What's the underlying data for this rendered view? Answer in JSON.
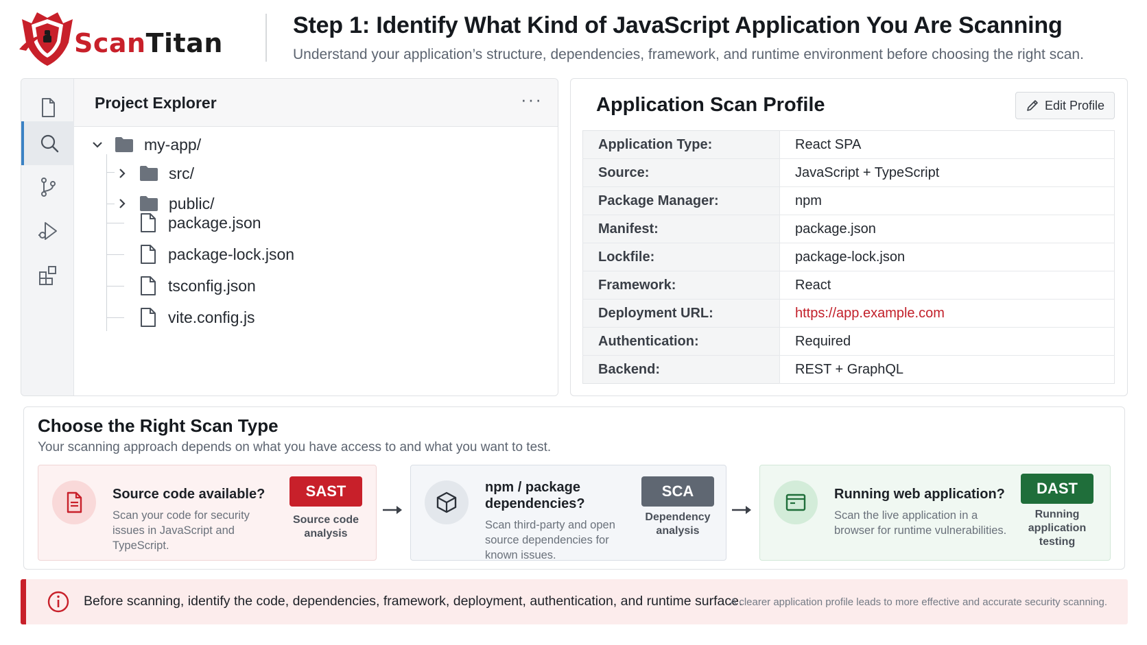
{
  "brand": {
    "name_part1": "Scan",
    "name_part2": "Titan"
  },
  "header": {
    "title": "Step 1: Identify What Kind of JavaScript Application You Are Scanning",
    "subtitle": "Understand your application’s structure, dependencies, framework, and runtime environment before choosing the right scan."
  },
  "explorer": {
    "title": "Project Explorer",
    "more": "···",
    "activity_icons": [
      "files-icon",
      "search-icon",
      "source-control-icon",
      "run-debug-icon",
      "extensions-icon"
    ],
    "tree": [
      {
        "label": "my-app/",
        "type": "folder",
        "expanded": true
      },
      {
        "label": "src/",
        "type": "folder",
        "expanded": false
      },
      {
        "label": "public/",
        "type": "folder",
        "expanded": false
      },
      {
        "label": "package.json",
        "type": "file"
      },
      {
        "label": "package-lock.json",
        "type": "file"
      },
      {
        "label": "tsconfig.json",
        "type": "file"
      },
      {
        "label": "vite.config.js",
        "type": "file"
      }
    ]
  },
  "profile": {
    "title": "Application Scan Profile",
    "edit_label": "Edit Profile",
    "rows": [
      {
        "key": "Application Type:",
        "value": "React SPA"
      },
      {
        "key": "Source:",
        "value": "JavaScript + TypeScript"
      },
      {
        "key": "Package Manager:",
        "value": "npm"
      },
      {
        "key": "Manifest:",
        "value": "package.json"
      },
      {
        "key": "Lockfile:",
        "value": "package-lock.json"
      },
      {
        "key": "Framework:",
        "value": "React"
      },
      {
        "key": "Deployment URL:",
        "value": "https://app.example.com"
      },
      {
        "key": "Authentication:",
        "value": "Required"
      },
      {
        "key": "Backend:",
        "value": "REST + GraphQL"
      }
    ]
  },
  "scan_types": {
    "title": "Choose the Right Scan Type",
    "subtitle": "Your scanning approach depends on what you have access to and what you want to test.",
    "cards": [
      {
        "heading": "Source code available?",
        "description": "Scan your code for security issues in JavaScript and TypeScript.",
        "badge": "SAST",
        "caption": "Source code analysis",
        "icon": "document-icon"
      },
      {
        "heading": "npm / package dependencies?",
        "description": "Scan third-party and open source dependencies for known issues.",
        "badge": "SCA",
        "caption": "Dependency analysis",
        "icon": "package-icon"
      },
      {
        "heading": "Running web application?",
        "description": "Scan the live application in a browser for runtime vulnerabilities.",
        "badge": "DAST",
        "caption": "Running application testing",
        "icon": "browser-window-icon"
      }
    ]
  },
  "info": {
    "main": "Before scanning, identify the code, dependencies, framework, deployment, authentication, and runtime surface.",
    "side": "A clearer application profile leads to more effective and accurate security scanning."
  },
  "colors": {
    "brand_red": "#c8202a",
    "sca_gray": "#5f6772",
    "dast_green": "#1f6e3a",
    "active_accent": "#3b82c4"
  }
}
